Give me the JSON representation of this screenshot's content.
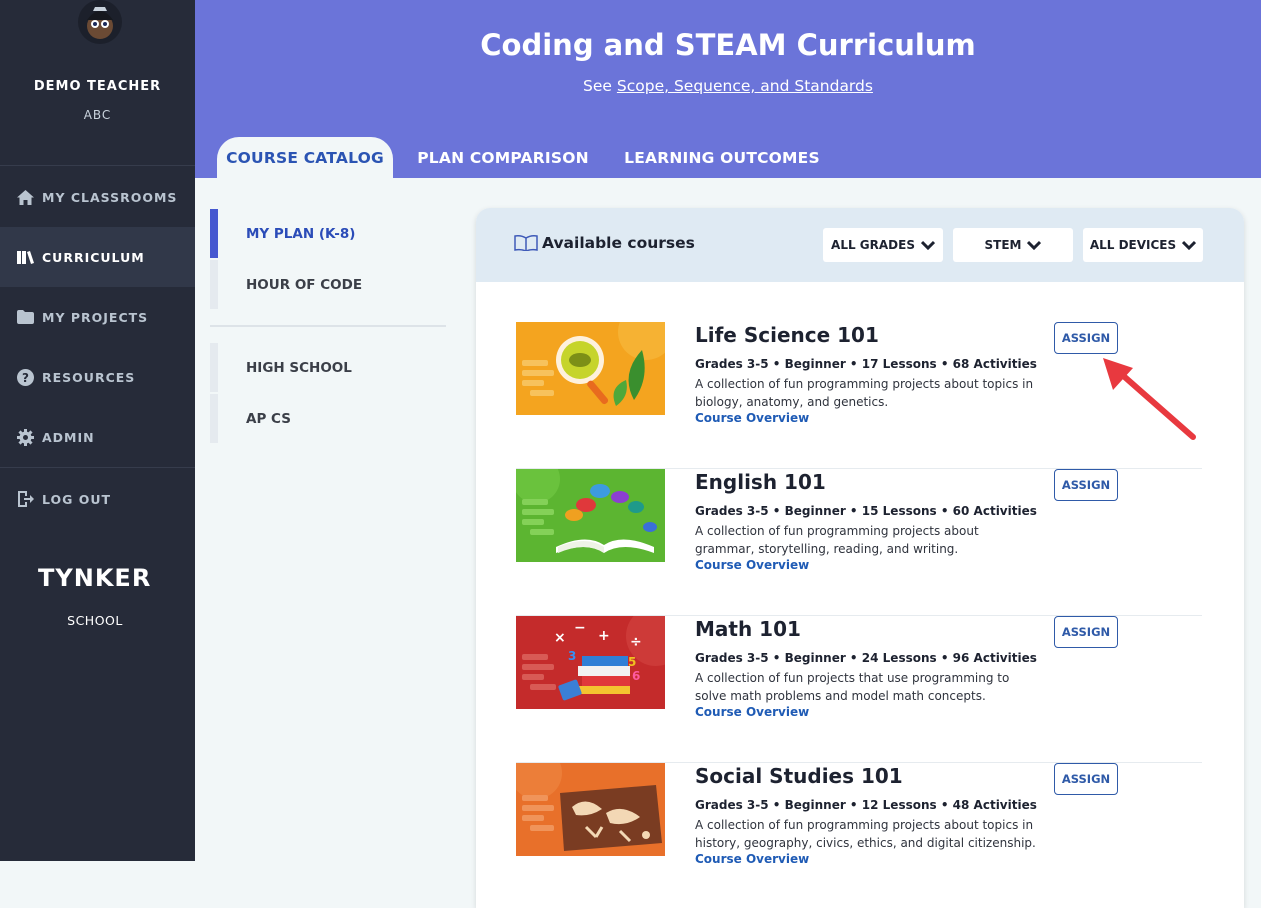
{
  "sidebar": {
    "user_name": "DEMO TEACHER",
    "user_org": "ABC",
    "items": [
      {
        "label": "MY CLASSROOMS",
        "icon": "home-icon"
      },
      {
        "label": "CURRICULUM",
        "icon": "book-icon"
      },
      {
        "label": "MY PROJECTS",
        "icon": "folder-icon"
      },
      {
        "label": "RESOURCES",
        "icon": "question-icon"
      },
      {
        "label": "ADMIN",
        "icon": "gear-icon"
      },
      {
        "label": "LOG OUT",
        "icon": "logout-icon"
      }
    ],
    "active_item": "CURRICULUM",
    "logo_text": "TYNKER",
    "logo_sub": "SCHOOL"
  },
  "header": {
    "title": "Coding and STEAM Curriculum",
    "subtitle_prefix": "See ",
    "subtitle_link": "Scope, Sequence, and Standards",
    "tabs": [
      {
        "label": "COURSE CATALOG"
      },
      {
        "label": "PLAN COMPARISON"
      },
      {
        "label": "LEARNING OUTCOMES"
      }
    ],
    "active_tab": "COURSE CATALOG"
  },
  "subnav": {
    "items": [
      {
        "label": "MY PLAN (K-8)"
      },
      {
        "label": "HOUR OF CODE"
      },
      {
        "label": "HIGH SCHOOL"
      },
      {
        "label": "AP CS"
      }
    ],
    "active_item": "MY PLAN (K-8)"
  },
  "catalog": {
    "title": "Available courses",
    "filters": [
      {
        "label": "ALL GRADES"
      },
      {
        "label": "STEM"
      },
      {
        "label": "ALL DEVICES"
      }
    ],
    "courses": [
      {
        "title": "Life Science 101",
        "meta": "Grades 3-5 • Beginner • 17 Lessons • 68 Activities",
        "description": "A collection of fun programming projects about topics in biology, anatomy, and genetics.",
        "link": "Course Overview",
        "button": "ASSIGN",
        "thumb_color": "#f4a41f"
      },
      {
        "title": "English 101",
        "meta": "Grades 3-5 • Beginner • 15 Lessons • 60 Activities",
        "description": "A collection of fun programming projects about grammar, storytelling, reading, and writing.",
        "link": "Course Overview",
        "button": "ASSIGN",
        "thumb_color": "#5cb531"
      },
      {
        "title": "Math 101",
        "meta": "Grades 3-5 • Beginner • 24 Lessons • 96 Activities",
        "description": "A collection of fun projects that use programming to solve math problems and model math concepts.",
        "link": "Course Overview",
        "button": "ASSIGN",
        "thumb_color": "#c42b2b"
      },
      {
        "title": "Social Studies 101",
        "meta": "Grades 3-5 • Beginner • 12 Lessons • 48 Activities",
        "description": "A collection of fun programming projects about topics in history, geography, civics, ethics, and digital citizenship.",
        "link": "Course Overview",
        "button": "ASSIGN",
        "thumb_color": "#e8702a"
      }
    ]
  },
  "colors": {
    "header_bg": "#6b74d9",
    "sidebar_bg": "#262b39",
    "accent": "#2b54b3",
    "annotation_arrow": "#e8393f"
  }
}
